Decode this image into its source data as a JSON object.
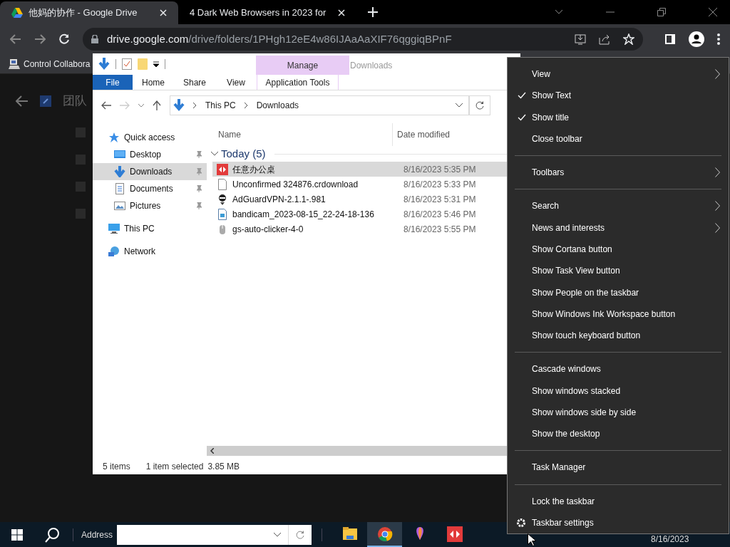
{
  "browser": {
    "tabs": [
      {
        "title": "他妈的协作 - Google Drive",
        "selected": true
      },
      {
        "title": "4 Dark Web Browsers in 2023 for",
        "selected": false
      }
    ],
    "url": {
      "host": "drive.google.com",
      "path": "/drive/folders/1PHgh12eE4w86IJAaAaXIF76qggiqBPnF"
    },
    "bookmarks": [
      "Control Collabora"
    ],
    "page": {
      "heading": "团队"
    }
  },
  "explorer": {
    "ribbon_tabs": [
      {
        "label": "File",
        "selected": true
      },
      {
        "label": "Home",
        "selected": false
      },
      {
        "label": "Share",
        "selected": false
      },
      {
        "label": "View",
        "selected": false
      },
      {
        "label": "Application Tools",
        "selected": false
      }
    ],
    "context_tab": "Manage",
    "title": "Downloads",
    "breadcrumb": [
      "This PC",
      "Downloads"
    ],
    "nav": [
      {
        "label": "Quick access",
        "selected": false,
        "pinned": false,
        "kind": "star",
        "children": [
          {
            "label": "Desktop",
            "selected": false,
            "pinned": true,
            "kind": "desktop"
          },
          {
            "label": "Downloads",
            "selected": true,
            "pinned": true,
            "kind": "download"
          },
          {
            "label": "Documents",
            "selected": false,
            "pinned": true,
            "kind": "document"
          },
          {
            "label": "Pictures",
            "selected": false,
            "pinned": true,
            "kind": "picture"
          }
        ]
      },
      {
        "label": "This PC",
        "selected": false,
        "pinned": false,
        "kind": "pc"
      },
      {
        "label": "Network",
        "selected": false,
        "pinned": false,
        "kind": "network"
      }
    ],
    "columns": [
      "Name",
      "Date modified"
    ],
    "group": "Today (5)",
    "files": [
      {
        "name": "任意办公桌",
        "date": "8/16/2023 5:35 PM",
        "selected": true,
        "kind": "app"
      },
      {
        "name": "Unconfirmed 324876.crdownload",
        "date": "8/16/2023 5:33 PM",
        "selected": false,
        "kind": "blank"
      },
      {
        "name": "AdGuardVPN-2.1.1-.981",
        "date": "8/16/2023 5:31 PM",
        "selected": false,
        "kind": "vpn"
      },
      {
        "name": "bandicam_2023-08-15_22-24-18-136",
        "date": "8/16/2023 5:46 PM",
        "selected": false,
        "kind": "video"
      },
      {
        "name": "gs-auto-clicker-4-0",
        "date": "8/16/2023 5:55 PM",
        "selected": false,
        "kind": "mouse"
      }
    ],
    "status": [
      "5 items",
      "1 item selected",
      "3.85 MB"
    ]
  },
  "context_menu": {
    "groups": [
      [
        {
          "label": "View",
          "checked": false,
          "submenu": true,
          "kind": "command"
        },
        {
          "label": "Show Text",
          "checked": true,
          "submenu": false,
          "kind": "command"
        },
        {
          "label": "Show title",
          "checked": true,
          "submenu": false,
          "kind": "command"
        },
        {
          "label": "Close toolbar",
          "checked": false,
          "submenu": false,
          "kind": "command"
        }
      ],
      [
        {
          "label": "Toolbars",
          "checked": false,
          "submenu": true,
          "kind": "command"
        }
      ],
      [
        {
          "label": "Search",
          "checked": false,
          "submenu": true,
          "kind": "command"
        },
        {
          "label": "News and interests",
          "checked": false,
          "submenu": true,
          "kind": "command"
        },
        {
          "label": "Show Cortana button",
          "checked": false,
          "submenu": false,
          "kind": "command"
        },
        {
          "label": "Show Task View button",
          "checked": false,
          "submenu": false,
          "kind": "command"
        },
        {
          "label": "Show People on the taskbar",
          "checked": false,
          "submenu": false,
          "kind": "command"
        },
        {
          "label": "Show Windows Ink Workspace button",
          "checked": false,
          "submenu": false,
          "kind": "command"
        },
        {
          "label": "Show touch keyboard button",
          "checked": false,
          "submenu": false,
          "kind": "command"
        }
      ],
      [
        {
          "label": "Cascade windows",
          "checked": false,
          "submenu": false,
          "kind": "command"
        },
        {
          "label": "Show windows stacked",
          "checked": false,
          "submenu": false,
          "kind": "command"
        },
        {
          "label": "Show windows side by side",
          "checked": false,
          "submenu": false,
          "kind": "command"
        },
        {
          "label": "Show the desktop",
          "checked": false,
          "submenu": false,
          "kind": "command"
        }
      ],
      [
        {
          "label": "Task Manager",
          "checked": false,
          "submenu": false,
          "kind": "command"
        }
      ],
      [
        {
          "label": "Lock the taskbar",
          "checked": false,
          "submenu": false,
          "kind": "command"
        },
        {
          "label": "Taskbar settings",
          "checked": false,
          "submenu": false,
          "kind": "settings"
        }
      ]
    ]
  },
  "taskbar": {
    "address_label": "Address",
    "apps": [
      {
        "kind": "folder",
        "selected": false
      },
      {
        "kind": "chrome",
        "selected": true
      },
      {
        "kind": "balloon",
        "selected": false
      },
      {
        "kind": "remote",
        "selected": false
      }
    ],
    "date": "8/16/2023"
  }
}
